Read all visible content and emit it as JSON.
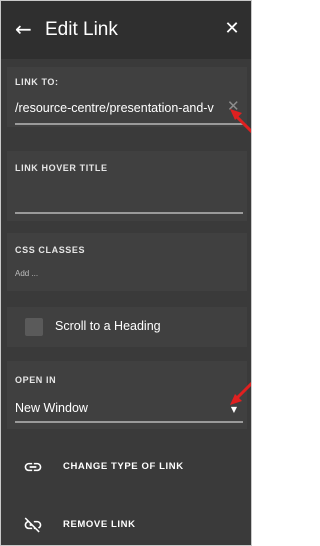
{
  "header": {
    "title": "Edit Link",
    "back_icon": "arrow-left-icon",
    "close_icon": "close-icon"
  },
  "link_to": {
    "label": "LINK TO:",
    "value": "/resource-centre/presentation-and-v",
    "clear_icon": "clear-icon"
  },
  "hover_title": {
    "label": "LINK HOVER TITLE",
    "value": ""
  },
  "css_classes": {
    "label": "CSS CLASSES",
    "placeholder": "Add ..."
  },
  "scroll": {
    "label": "Scroll to a Heading",
    "checked": false
  },
  "open_in": {
    "label": "OPEN IN",
    "value": "New Window"
  },
  "actions": {
    "change_type": "CHANGE TYPE OF LINK",
    "remove": "REMOVE LINK"
  },
  "colors": {
    "panel": "#3a3a3a",
    "header": "#2f2f2f",
    "section": "#404040",
    "annotation_arrow": "#e02020"
  }
}
